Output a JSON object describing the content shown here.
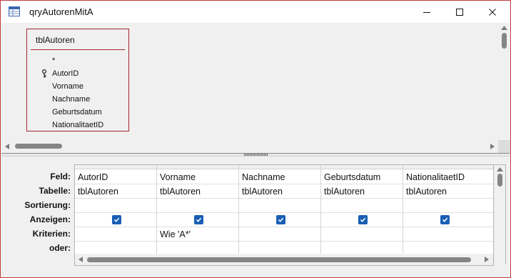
{
  "window": {
    "title": "qryAutorenMitA",
    "minimize_symbol": "─",
    "close_symbol": "✕"
  },
  "table_box": {
    "title": "tblAutoren",
    "fields": [
      "*",
      "AutorID",
      "Vorname",
      "Nachname",
      "Geburtsdatum",
      "NationalitaetID"
    ],
    "primary_key_field": "AutorID"
  },
  "grid": {
    "row_labels": [
      "Feld:",
      "Tabelle:",
      "Sortierung:",
      "Anzeigen:",
      "Kriterien:",
      "oder:"
    ],
    "columns": [
      {
        "feld": "AutorID",
        "tabelle": "tblAutoren",
        "sortierung": "",
        "anzeigen": true,
        "kriterien": "",
        "oder": ""
      },
      {
        "feld": "Vorname",
        "tabelle": "tblAutoren",
        "sortierung": "",
        "anzeigen": true,
        "kriterien": "Wie 'A*'",
        "oder": ""
      },
      {
        "feld": "Nachname",
        "tabelle": "tblAutoren",
        "sortierung": "",
        "anzeigen": true,
        "kriterien": "",
        "oder": ""
      },
      {
        "feld": "Geburtsdatum",
        "tabelle": "tblAutoren",
        "sortierung": "",
        "anzeigen": true,
        "kriterien": "",
        "oder": ""
      },
      {
        "feld": "NationalitaetID",
        "tabelle": "tblAutoren",
        "sortierung": "",
        "anzeigen": true,
        "kriterien": "",
        "oder": ""
      }
    ]
  },
  "icons": {
    "window": "query-icon",
    "key": "key-icon",
    "check": "checkmark-icon"
  },
  "colors": {
    "accent": "#a4262c",
    "checkbox": "#1a5fb4",
    "scroll_thumb": "#858585"
  }
}
